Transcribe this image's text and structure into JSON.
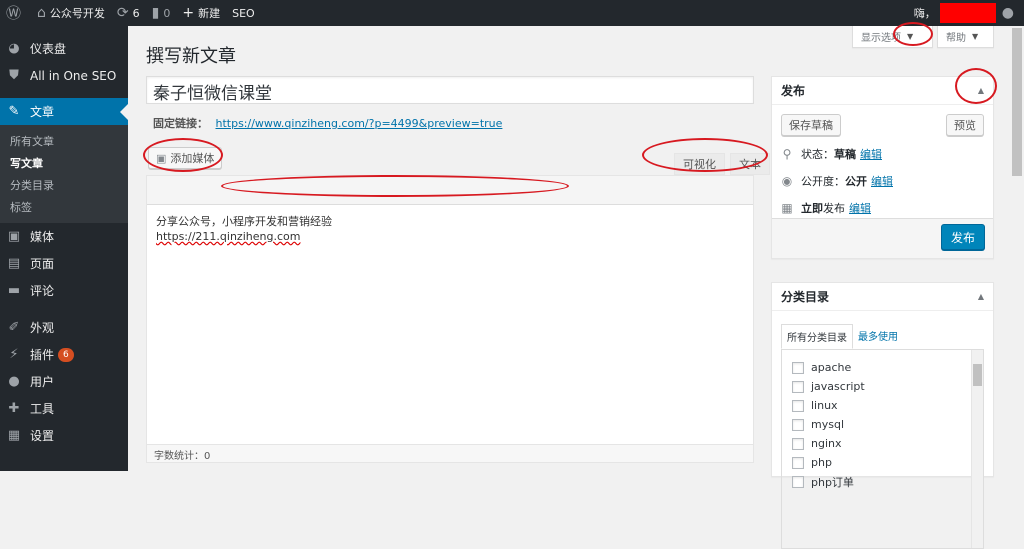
{
  "adminbar": {
    "site_name": "公众号开发",
    "updates_count": "6",
    "comments_count": "0",
    "new_label": "新建",
    "seo_label": "SEO",
    "greeting": "嗨，"
  },
  "sidebar": {
    "items": [
      {
        "label": "仪表盘",
        "icon": "dashboard-icon"
      },
      {
        "label": "All in One SEO",
        "icon": "shield-icon"
      },
      {
        "label": "文章",
        "icon": "pin-icon"
      },
      {
        "label": "媒体",
        "icon": "media-icon"
      },
      {
        "label": "页面",
        "icon": "page-icon"
      },
      {
        "label": "评论",
        "icon": "comment-icon"
      },
      {
        "label": "外观",
        "icon": "brush-icon"
      },
      {
        "label": "插件",
        "icon": "plugin-icon",
        "badge": "6"
      },
      {
        "label": "用户",
        "icon": "user-icon"
      },
      {
        "label": "工具",
        "icon": "wrench-icon"
      },
      {
        "label": "设置",
        "icon": "settings-icon"
      }
    ],
    "submenu": [
      "所有文章",
      "写文章",
      "分类目录",
      "标签"
    ]
  },
  "screen_options": {
    "label": "显示选项",
    "help": "帮助"
  },
  "editor": {
    "page_title": "撰写新文章",
    "title_value": "秦子恒微信课堂",
    "permalink_label": "固定链接：",
    "permalink_url": "https://www.qinziheng.com/?p=4499&preview=true",
    "add_media": "添加媒体",
    "tab_visual": "可视化",
    "tab_text": "文本",
    "content_line1": "分享公众号，小程序开发和营销经验",
    "content_line2": "https://211.qinziheng.com",
    "word_count": "字数统计：0"
  },
  "publish": {
    "title": "发布",
    "save_draft": "保存草稿",
    "preview": "预览",
    "status_label": "状态：",
    "status_value": "草稿",
    "visibility_label": "公开度：",
    "visibility_value": "公开",
    "schedule_bold": "立即",
    "schedule_rest": "发布",
    "edit": "编辑",
    "publish_button": "发布"
  },
  "categories": {
    "title": "分类目录",
    "tab_all": "所有分类目录",
    "tab_popular": "最多使用",
    "items": [
      "apache",
      "javascript",
      "linux",
      "mysql",
      "nginx",
      "php",
      "php订单"
    ]
  },
  "colors": {
    "accent": "#0073aa",
    "primary_button": "#0085ba",
    "annotation": "#d71920",
    "adminbar": "#23282d"
  }
}
